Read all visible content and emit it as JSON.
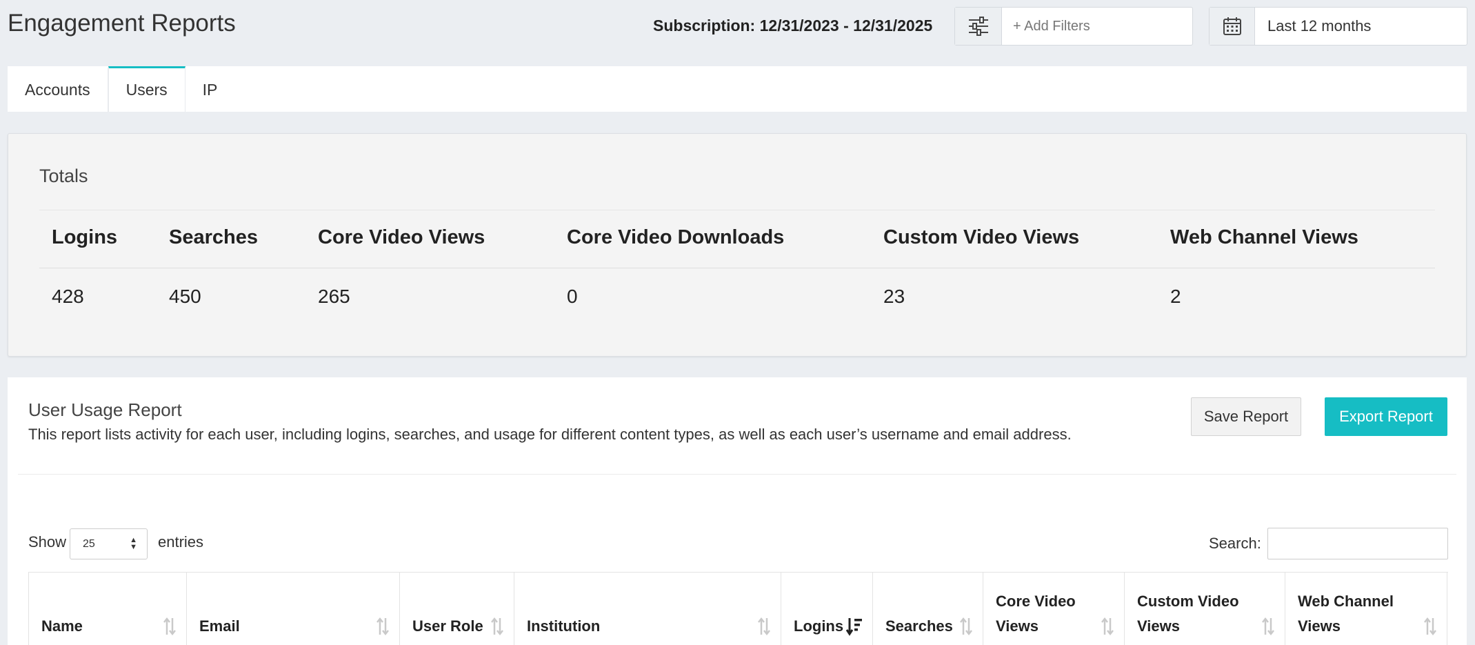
{
  "header": {
    "title": "Engagement Reports",
    "subscription": "Subscription: 12/31/2023 - 12/31/2025",
    "filter_placeholder": "+ Add Filters",
    "date_range": "Last 12 months",
    "filter_icon": "sliders-icon",
    "calendar_icon": "calendar-icon"
  },
  "tabs": [
    {
      "label": "Accounts",
      "active": false
    },
    {
      "label": "Users",
      "active": true
    },
    {
      "label": "IP",
      "active": false
    }
  ],
  "totals": {
    "title": "Totals",
    "columns": [
      {
        "label": "Logins",
        "value": "428"
      },
      {
        "label": "Searches",
        "value": "450"
      },
      {
        "label": "Core Video Views",
        "value": "265"
      },
      {
        "label": "Core Video Downloads",
        "value": "0"
      },
      {
        "label": "Custom Video Views",
        "value": "23"
      },
      {
        "label": "Web Channel Views",
        "value": "2"
      }
    ]
  },
  "report": {
    "title": "User Usage Report",
    "description": "This report lists activity for each user, including logins, searches, and usage for different content types, as well as each user’s username and email address.",
    "save_label": "Save Report",
    "export_label": "Export Report",
    "show_label": "Show",
    "entries_value": "25",
    "entries_label": "entries",
    "search_label": "Search:",
    "search_value": "",
    "columns": [
      {
        "label": "Name",
        "sort": "none"
      },
      {
        "label": "Email",
        "sort": "none"
      },
      {
        "label": "User Role",
        "sort": "none"
      },
      {
        "label": "Institution",
        "sort": "none"
      },
      {
        "label": "Logins",
        "sort": "descending"
      },
      {
        "label": "Searches",
        "sort": "none"
      },
      {
        "label": "Core Video Views",
        "sort": "none"
      },
      {
        "label": "Custom Video Views",
        "sort": "none"
      },
      {
        "label": "Web Channel Views",
        "sort": "none"
      }
    ]
  },
  "colors": {
    "accent": "#16bdc4",
    "background": "#ebeef2"
  }
}
